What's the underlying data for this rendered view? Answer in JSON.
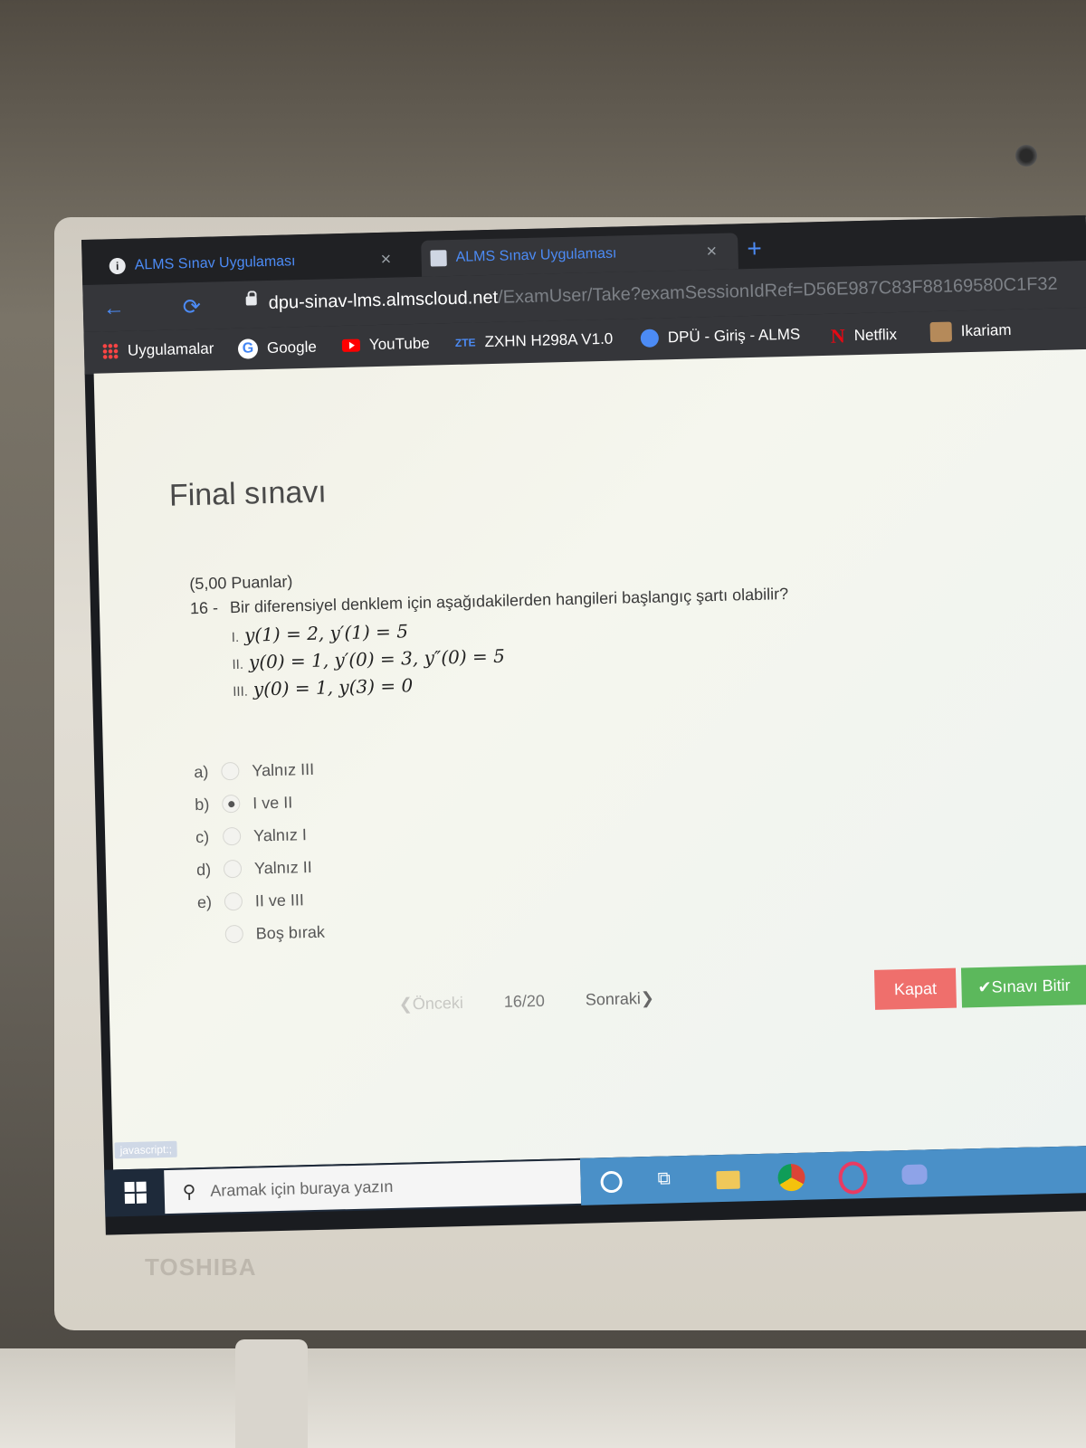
{
  "device": {
    "brand": "TOSHIBA"
  },
  "browser": {
    "tabs": [
      {
        "label": "ALMS Sınav Uygulaması",
        "icon": "info-icon",
        "active": false
      },
      {
        "label": "ALMS Sınav Uygulaması",
        "icon": "document-icon",
        "active": true
      }
    ],
    "close_glyph": "×",
    "new_tab_glyph": "+",
    "url_host": "dpu-sinav-lms.almscloud.net",
    "url_path": "/ExamUser/Take?examSessionIdRef=D56E987C83F88169580C1F32",
    "bookmarks": [
      {
        "label": "Uygulamalar",
        "icon": "apps-icon"
      },
      {
        "label": "Google",
        "icon": "google-icon"
      },
      {
        "label": "YouTube",
        "icon": "youtube-icon"
      },
      {
        "label": "ZXHN H298A V1.0",
        "icon": "zte-icon"
      },
      {
        "label": "DPÜ - Giriş - ALMS",
        "icon": "globe-icon"
      },
      {
        "label": "Netflix",
        "icon": "netflix-icon"
      },
      {
        "label": "Ikariam",
        "icon": "ikariam-icon"
      }
    ]
  },
  "exam": {
    "title": "Final sınavı",
    "points": "(5,00 Puanlar)",
    "question_number": "16 -",
    "question_text": "Bir diferensiyel denklem için aşağıdakilerden hangileri başlangıç şartı olabilir?",
    "statements": [
      {
        "roman": "I.",
        "math": "y(1) = 2, y′(1) = 5"
      },
      {
        "roman": "II.",
        "math": "y(0) = 1, y′(0) = 3, y″(0) = 5"
      },
      {
        "roman": "III.",
        "math": "y(0) = 1, y(3) = 0"
      }
    ],
    "options": [
      {
        "letter": "a)",
        "label": "Yalnız III",
        "checked": false
      },
      {
        "letter": "b)",
        "label": "I ve II",
        "checked": true
      },
      {
        "letter": "c)",
        "label": "Yalnız I",
        "checked": false
      },
      {
        "letter": "d)",
        "label": "Yalnız II",
        "checked": false
      },
      {
        "letter": "e)",
        "label": "II ve III",
        "checked": false
      },
      {
        "letter": "",
        "label": "Boş bırak",
        "checked": false
      }
    ],
    "pager": {
      "prev": "❮Önceki",
      "count": "16/20",
      "next": "Sonraki❯"
    },
    "buttons": {
      "close": "Kapat",
      "finish": "✔Sınavı Bitir"
    }
  },
  "status_link": "javascript:;",
  "taskbar": {
    "search_placeholder": "Aramak için buraya yazın"
  },
  "colors": {
    "tab_accent": "#4c8bf5",
    "close_button": "#ef6f6c",
    "finish_button": "#5cb85c"
  }
}
